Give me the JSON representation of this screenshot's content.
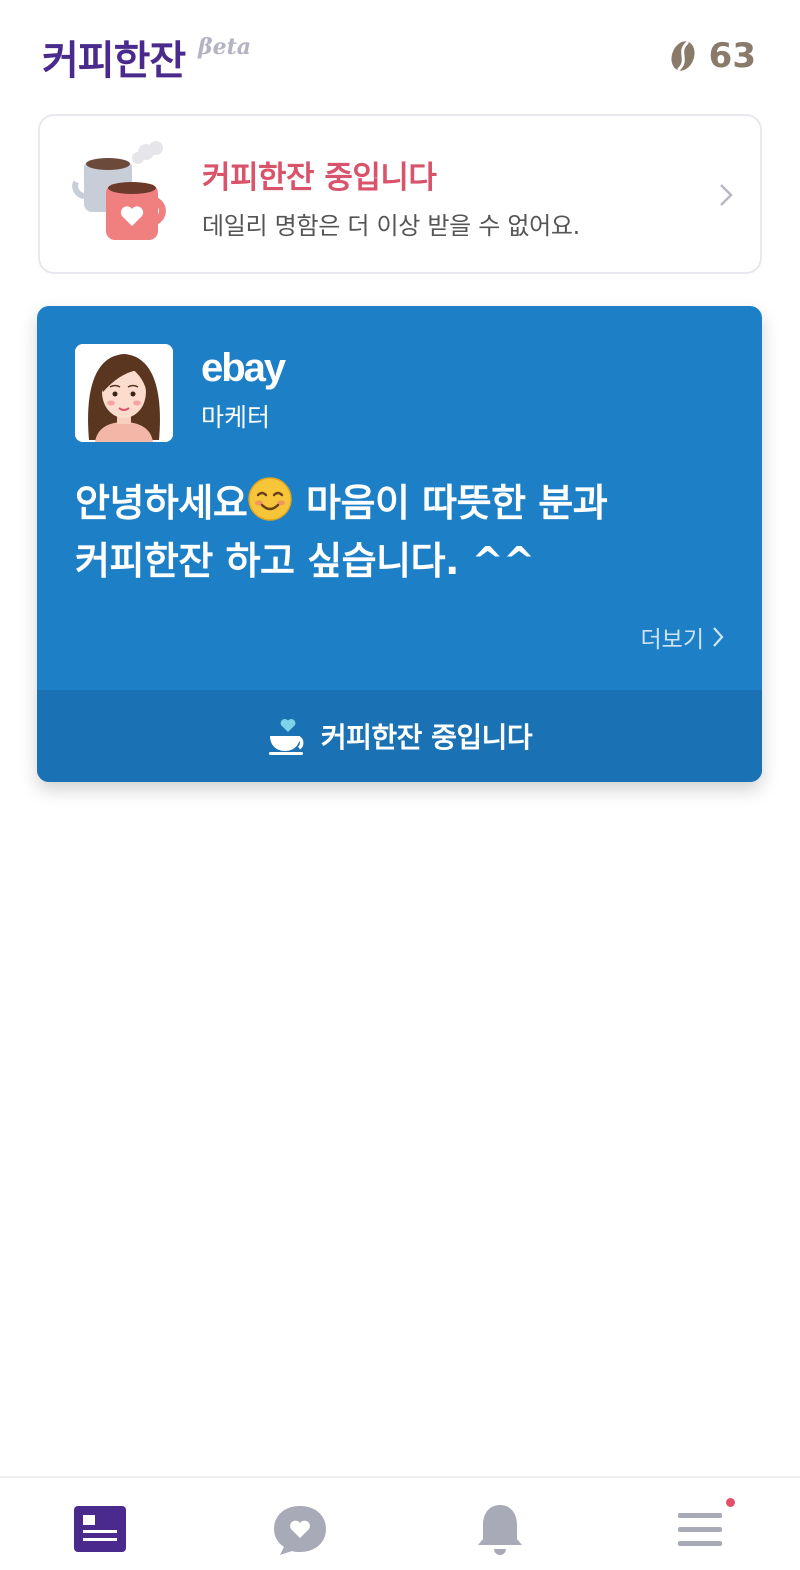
{
  "header": {
    "app_title": "커피한잔",
    "beta_label": "βeta",
    "bean_count": "63",
    "bean_icon": "coffee-bean-icon"
  },
  "status_card": {
    "title": "커피한잔 중입니다",
    "subtitle": "데일리 명함은 더 이상 받을 수 없어요.",
    "illustration": "coffee-mugs-illustration",
    "chevron_icon": "chevron-right-icon"
  },
  "profile_card": {
    "company": "ebay",
    "job_title": "마케터",
    "intro_line_1_before": "안녕하세요",
    "intro_line_1_after": " 마음이 따뜻한 분과",
    "intro_line_2": "커피한잔 하고 싶습니다. ^^",
    "emoji": "smiling-face-emoji",
    "more_label": "더보기",
    "footer_label": "커피한잔 중입니다",
    "footer_icon": "coffee-cup-heart-icon",
    "background_color": "#1d80c6",
    "footer_color": "#1a72b4"
  },
  "bottom_nav": {
    "items": [
      {
        "icon": "feed-icon",
        "active": true
      },
      {
        "icon": "chat-heart-icon",
        "active": false
      },
      {
        "icon": "bell-icon",
        "active": false
      },
      {
        "icon": "menu-icon",
        "active": false,
        "has_badge": true
      }
    ],
    "active_color": "#4a2a8c",
    "inactive_color": "#a9aab8",
    "badge_color": "#e0506c"
  }
}
